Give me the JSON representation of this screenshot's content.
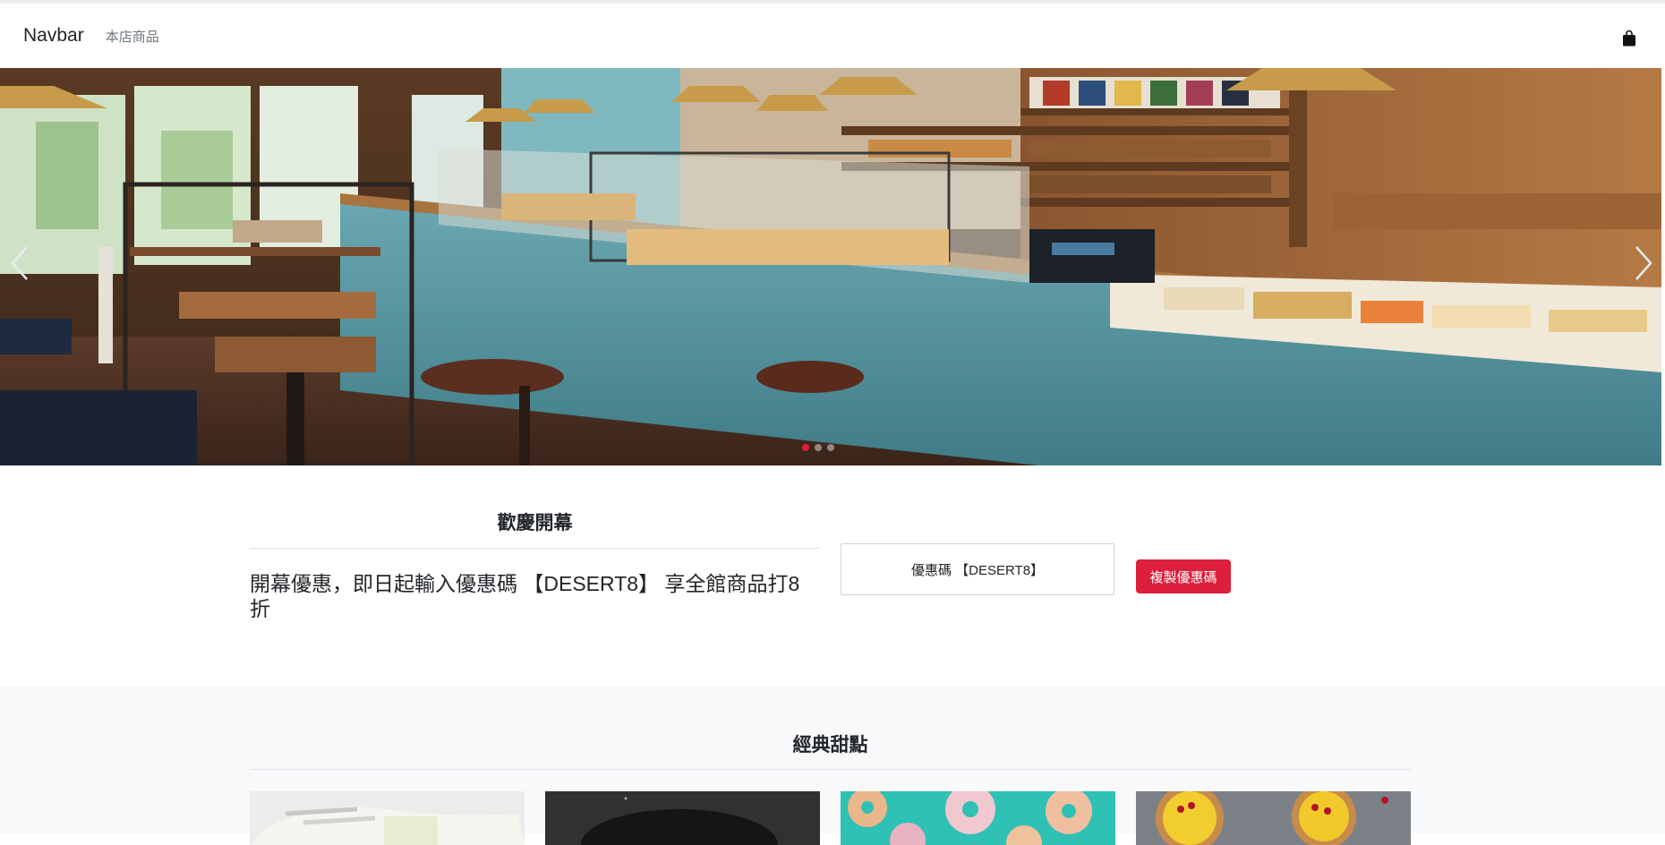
{
  "navbar": {
    "brand": "Navbar",
    "links": [
      "本店商品"
    ],
    "cart_icon": "shopping-bag-icon"
  },
  "hero": {
    "image": "bakery-cafe-interior",
    "prev_icon": "chevron-left-icon",
    "next_icon": "chevron-right-icon",
    "slides_count": 3,
    "active_slide": 1
  },
  "welcome": {
    "title": "歡慶開幕",
    "text": "開幕優惠，即日起輸入優惠碼 【DESERT8】 享全館商品打8折",
    "coupon_value": "優惠碼 【DESERT8】",
    "copy_button": "複製優惠碼"
  },
  "classic": {
    "title": "經典甜點",
    "cards": [
      {
        "image": "cake-slice-photo"
      },
      {
        "image": "dark-plate-photo"
      },
      {
        "image": "sprinkle-donuts-photo"
      },
      {
        "image": "lemon-tarts-photo"
      }
    ]
  },
  "colors": {
    "accent": "#dc1f3a",
    "section_bg": "#f8f9fa",
    "counter_teal": "#4f8f9a"
  }
}
